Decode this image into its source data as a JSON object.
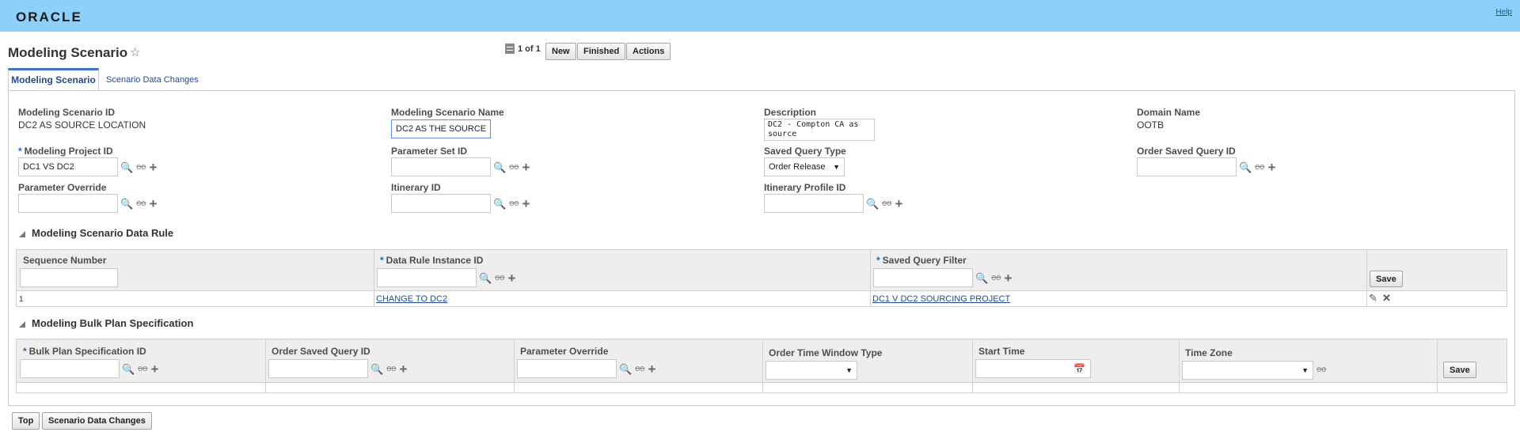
{
  "header": {
    "logo": "ORACLE",
    "help": "Help"
  },
  "page": {
    "title": "Modeling Scenario",
    "pager": "1 of 1"
  },
  "toolbar": {
    "new": "New",
    "finished": "Finished",
    "actions": "Actions"
  },
  "tabs": [
    {
      "label": "Modeling Scenario",
      "active": true
    },
    {
      "label": "Scenario Data Changes",
      "active": false
    }
  ],
  "form": {
    "scenario_id": {
      "label": "Modeling Scenario ID",
      "value": "DC2 AS SOURCE LOCATION"
    },
    "scenario_name": {
      "label": "Modeling Scenario Name",
      "value": "DC2 AS THE SOURCE"
    },
    "description": {
      "label": "Description",
      "value": "DC2 - Compton CA as source"
    },
    "domain_name": {
      "label": "Domain Name",
      "value": "OOTB"
    },
    "project_id": {
      "label": "Modeling Project ID",
      "required": "*",
      "value": "DC1 VS DC2"
    },
    "parameter_set_id": {
      "label": "Parameter Set ID",
      "value": ""
    },
    "saved_query_type": {
      "label": "Saved Query Type",
      "value": "Order Release"
    },
    "order_saved_query_id": {
      "label": "Order Saved Query ID",
      "value": ""
    },
    "parameter_override": {
      "label": "Parameter Override",
      "value": ""
    },
    "itinerary_id": {
      "label": "Itinerary ID",
      "value": ""
    },
    "itinerary_profile_id": {
      "label": "Itinerary Profile ID",
      "value": ""
    }
  },
  "data_rule": {
    "title": "Modeling Scenario Data Rule",
    "columns": [
      {
        "label": "Sequence Number",
        "required": ""
      },
      {
        "label": "Data Rule Instance ID",
        "required": "*"
      },
      {
        "label": "Saved Query Filter",
        "required": "*"
      }
    ],
    "save": "Save",
    "rows": [
      {
        "seq": "1",
        "rule": "CHANGE TO DC2",
        "filter": "DC1 V DC2 SOURCING PROJECT"
      }
    ]
  },
  "bulk_plan": {
    "title": "Modeling Bulk Plan Specification",
    "columns": [
      {
        "label": "Bulk Plan Specification ID",
        "required": "*"
      },
      {
        "label": "Order Saved Query ID",
        "required": ""
      },
      {
        "label": "Parameter Override",
        "required": ""
      },
      {
        "label": "Order Time Window Type",
        "required": ""
      },
      {
        "label": "Start Time",
        "required": ""
      },
      {
        "label": "Time Zone",
        "required": ""
      }
    ],
    "save": "Save"
  },
  "footer": {
    "top": "Top",
    "scenario_changes": "Scenario Data Changes"
  },
  "icons": {
    "search": "search-icon",
    "glasses": "view-glasses-icon",
    "add": "add-plus-icon",
    "star": "star-icon",
    "edit": "pencil-icon",
    "delete": "close-x-icon",
    "calendar": "calendar-icon"
  },
  "colors": {
    "banner": "#8dd1fa",
    "link": "#1f4e96",
    "required": "#1f66c9"
  }
}
